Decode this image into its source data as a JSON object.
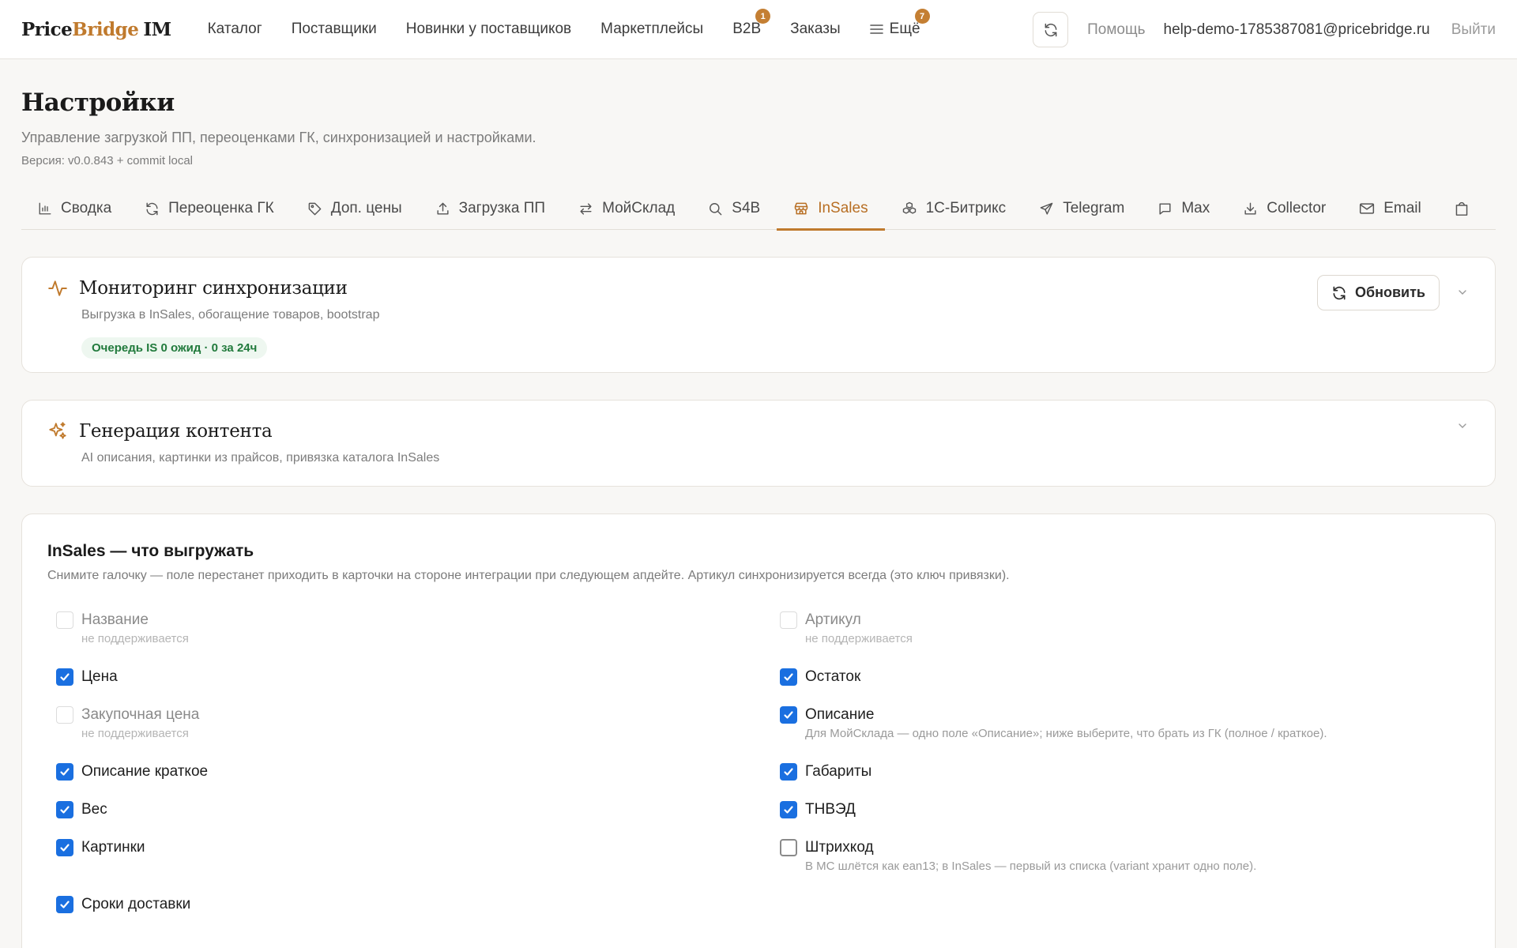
{
  "brand": {
    "part1": "Price",
    "part2": "Bridge",
    "part3": "IM"
  },
  "nav": {
    "items": [
      {
        "label": "Каталог"
      },
      {
        "label": "Поставщики"
      },
      {
        "label": "Новинки у поставщиков"
      },
      {
        "label": "Маркетплейсы"
      },
      {
        "label": "B2B",
        "badge": "1"
      },
      {
        "label": "Заказы"
      },
      {
        "label": "Ещё",
        "badge": "7"
      }
    ],
    "help": "Помощь",
    "email": "help-demo-1785387081@pricebridge.ru",
    "logout": "Выйти"
  },
  "header": {
    "title": "Настройки",
    "subtitle": "Управление загрузкой ПП, переоценками ГК, синхронизацией и настройками.",
    "version": "Версия: v0.0.843 + commit local"
  },
  "tabs": [
    {
      "label": "Сводка",
      "icon": "bar-chart-icon"
    },
    {
      "label": "Переоценка ГК",
      "icon": "refresh-icon"
    },
    {
      "label": "Доп. цены",
      "icon": "tag-icon"
    },
    {
      "label": "Загрузка ПП",
      "icon": "upload-icon"
    },
    {
      "label": "МойСклад",
      "icon": "arrows-swap-icon"
    },
    {
      "label": "S4B",
      "icon": "search-icon"
    },
    {
      "label": "InSales",
      "icon": "store-icon",
      "active": true
    },
    {
      "label": "1С-Битрикс",
      "icon": "cubes-icon"
    },
    {
      "label": "Telegram",
      "icon": "send-icon"
    },
    {
      "label": "Max",
      "icon": "chat-icon"
    },
    {
      "label": "Collector",
      "icon": "download-icon"
    },
    {
      "label": "Email",
      "icon": "mail-icon"
    },
    {
      "label": "",
      "icon": "bag-icon"
    }
  ],
  "monitoring": {
    "title": "Мониторинг синхронизации",
    "desc": "Выгрузка в InSales, обогащение товаров, bootstrap",
    "status_prefix": "Очередь IS",
    "status_value": "0 ожид · 0 за 24ч",
    "update_label": "Обновить"
  },
  "generation": {
    "title": "Генерация контента",
    "desc": "AI описания, картинки из прайсов, привязка каталога InSales"
  },
  "insales": {
    "title": "InSales — что выгружать",
    "desc": "Снимите галочку — поле перестанет приходить в карточки на стороне интеграции при следующем апдейте. Артикул синхронизируется всегда (это ключ привязки).",
    "left": [
      {
        "label": "Название",
        "state": "disabled",
        "note": "не поддерживается"
      },
      {
        "label": "Цена",
        "state": "checked"
      },
      {
        "label": "Закупочная цена",
        "state": "disabled",
        "note": "не поддерживается"
      },
      {
        "label": "Описание краткое",
        "state": "checked"
      },
      {
        "label": "Вес",
        "state": "checked"
      },
      {
        "label": "Картинки",
        "state": "checked"
      },
      {
        "label": "Сроки доставки",
        "state": "checked"
      }
    ],
    "right": [
      {
        "label": "Артикул",
        "state": "disabled",
        "note": "не поддерживается"
      },
      {
        "label": "Остаток",
        "state": "checked"
      },
      {
        "label": "Описание",
        "state": "checked",
        "note": "Для МойСклада — одно поле «Описание»; ниже выберите, что брать из ГК (полное / краткое)."
      },
      {
        "label": "Габариты",
        "state": "checked"
      },
      {
        "label": "ТНВЭД",
        "state": "checked"
      },
      {
        "label": "Штрихкод",
        "state": "unchecked",
        "note": "В МС шлётся как ean13; в InSales — первый из списка (variant хранит одно поле)."
      }
    ]
  },
  "colors": {
    "accent": "#c07a2d",
    "checkbox": "#1a6fe0",
    "status_green": "#217a3c"
  }
}
